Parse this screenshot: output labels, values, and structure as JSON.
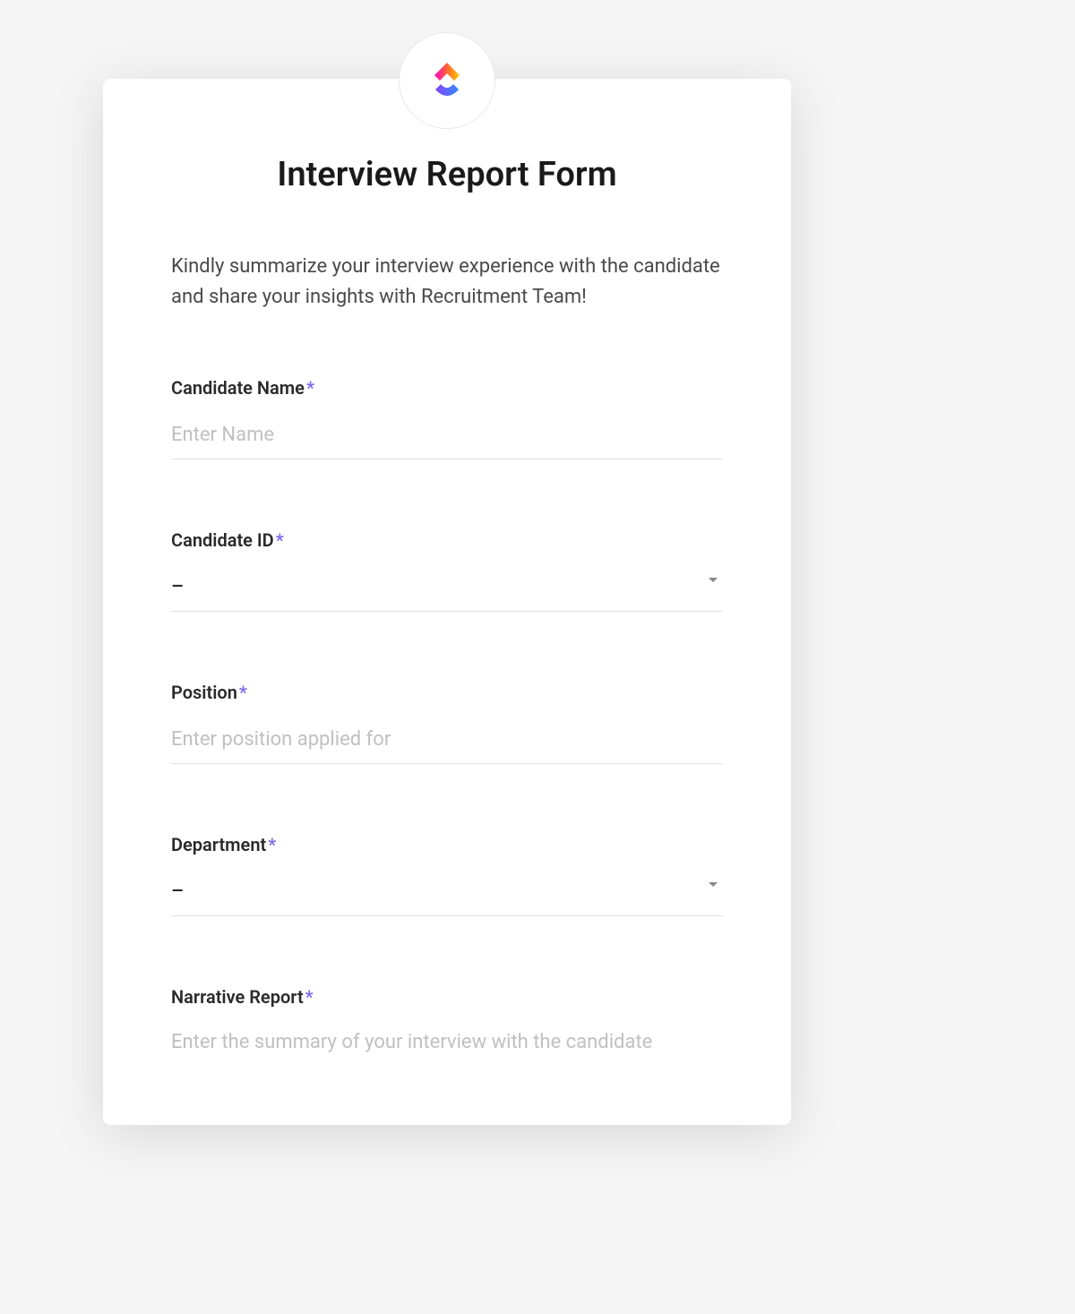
{
  "form": {
    "title": "Interview Report Form",
    "description": "Kindly summarize your interview experience with the candidate and share your insights with Recruitment Team!",
    "fields": {
      "candidate_name": {
        "label": "Candidate Name",
        "placeholder": "Enter Name",
        "required": true
      },
      "candidate_id": {
        "label": "Candidate ID",
        "value": "–",
        "required": true
      },
      "position": {
        "label": "Position",
        "placeholder": "Enter position applied for",
        "required": true
      },
      "department": {
        "label": "Department",
        "value": "–",
        "required": true
      },
      "narrative_report": {
        "label": "Narrative Report",
        "placeholder": "Enter the summary of your interview with the candidate",
        "required": true
      }
    },
    "required_marker": "*"
  }
}
